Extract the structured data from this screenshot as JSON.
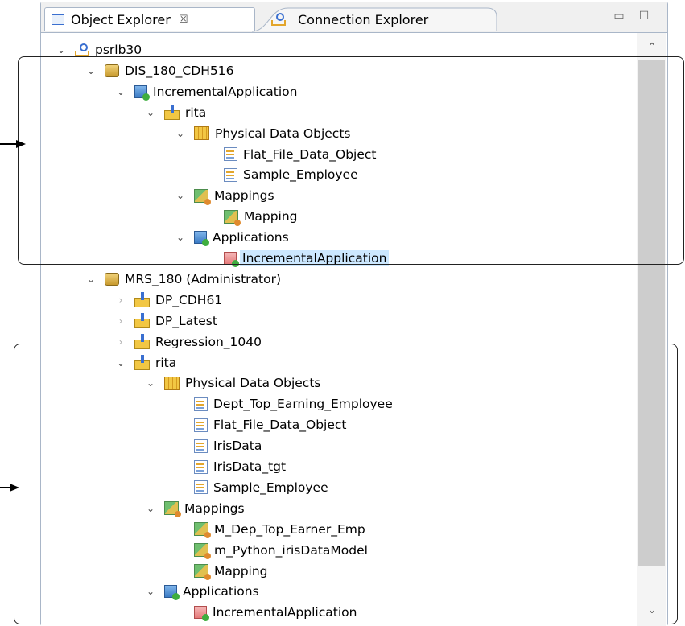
{
  "tabs": {
    "object_explorer": "Object Explorer",
    "object_explorer_close": "☒",
    "connection_explorer": "Connection Explorer"
  },
  "window_controls": {
    "minimize": "▭",
    "maximize": "☐"
  },
  "scrollbar": {
    "up": "⌃",
    "down": "⌄"
  },
  "tree": [
    {
      "label": "psrlb30",
      "icon": "domain-icon",
      "level": 0,
      "state": "expanded"
    },
    {
      "label": "DIS_180_CDH516",
      "icon": "integration-service-icon",
      "level": 1,
      "state": "expanded"
    },
    {
      "label": "IncrementalApplication",
      "icon": "application-icon",
      "level": 2,
      "state": "expanded"
    },
    {
      "label": "rita",
      "icon": "project-icon",
      "level": 3,
      "state": "expanded"
    },
    {
      "label": "Physical Data Objects",
      "icon": "folder-icon",
      "level": 4,
      "state": "expanded"
    },
    {
      "label": "Flat_File_Data_Object",
      "icon": "data-object-icon",
      "level": 5,
      "state": "leaf"
    },
    {
      "label": "Sample_Employee",
      "icon": "data-object-icon",
      "level": 5,
      "state": "leaf"
    },
    {
      "label": "Mappings",
      "icon": "mapping-icon",
      "level": 4,
      "state": "expanded"
    },
    {
      "label": "Mapping",
      "icon": "mapping-icon",
      "level": 5,
      "state": "leaf"
    },
    {
      "label": "Applications",
      "icon": "application-icon",
      "level": 4,
      "state": "expanded"
    },
    {
      "label": "IncrementalApplication",
      "icon": "deployed-application-icon",
      "level": 5,
      "state": "leaf",
      "selected": true
    },
    {
      "label": "MRS_180 (Administrator)",
      "icon": "repository-icon",
      "level": 1,
      "state": "expanded"
    },
    {
      "label": "DP_CDH61",
      "icon": "project-icon",
      "level": 2,
      "state": "collapsed"
    },
    {
      "label": "DP_Latest",
      "icon": "project-icon",
      "level": 2,
      "state": "collapsed"
    },
    {
      "label": "Regression_1040",
      "icon": "project-icon",
      "level": 2,
      "state": "collapsed"
    },
    {
      "label": "rita",
      "icon": "project-icon",
      "level": 2,
      "state": "expanded"
    },
    {
      "label": "Physical Data Objects",
      "icon": "folder-icon",
      "level": 3,
      "state": "expanded"
    },
    {
      "label": "Dept_Top_Earning_Employee",
      "icon": "data-object-icon",
      "level": 4,
      "state": "leaf"
    },
    {
      "label": "Flat_File_Data_Object",
      "icon": "data-object-icon",
      "level": 4,
      "state": "leaf"
    },
    {
      "label": "IrisData",
      "icon": "data-object-icon",
      "level": 4,
      "state": "leaf"
    },
    {
      "label": "IrisData_tgt",
      "icon": "data-object-icon",
      "level": 4,
      "state": "leaf"
    },
    {
      "label": "Sample_Employee",
      "icon": "data-object-icon",
      "level": 4,
      "state": "leaf"
    },
    {
      "label": "Mappings",
      "icon": "mapping-icon",
      "level": 3,
      "state": "expanded"
    },
    {
      "label": "M_Dep_Top_Earner_Emp",
      "icon": "mapping-icon",
      "level": 4,
      "state": "leaf"
    },
    {
      "label": "m_Python_irisDataModel",
      "icon": "mapping-icon",
      "level": 4,
      "state": "leaf"
    },
    {
      "label": "Mapping",
      "icon": "mapping-icon",
      "level": 4,
      "state": "leaf"
    },
    {
      "label": "Applications",
      "icon": "application-icon",
      "level": 3,
      "state": "expanded"
    },
    {
      "label": "IncrementalApplication",
      "icon": "deployed-application-icon",
      "level": 4,
      "state": "leaf"
    }
  ]
}
